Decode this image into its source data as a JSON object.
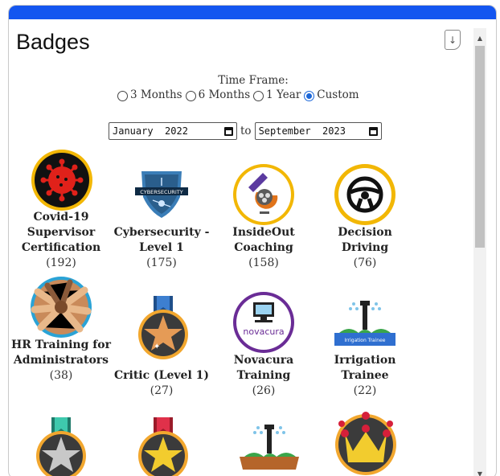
{
  "page": {
    "title": "Badges"
  },
  "toolbar": {
    "download_icon": "download-icon",
    "download_glyph": "↓"
  },
  "timeframe": {
    "label": "Time Frame:",
    "options": [
      "3 Months",
      "6 Months",
      "1 Year",
      "Custom"
    ],
    "selected": "Custom",
    "start": "January  2022",
    "separator": "to",
    "end": "September  2023"
  },
  "badges": [
    {
      "name": "Covid-19 Supervisor Certification",
      "count": "(192)",
      "icon": "virus-badge-icon"
    },
    {
      "name": "Cybersecurity - Level 1",
      "count": "(175)",
      "icon": "cybersecurity-shield-icon"
    },
    {
      "name": "InsideOut Coaching",
      "count": "(158)",
      "icon": "insideout-badge-icon"
    },
    {
      "name": "Decision Driving",
      "count": "(76)",
      "icon": "steering-wheel-icon"
    },
    {
      "name": "HR Training for Administrators",
      "count": "(38)",
      "icon": "team-hands-icon"
    },
    {
      "name": "Critic (Level 1)",
      "count": "(27)",
      "icon": "bronze-star-medal-icon"
    },
    {
      "name": "Novacura Training",
      "count": "(26)",
      "icon": "novacura-computer-icon"
    },
    {
      "name": "Irrigation Trainee",
      "count": "(22)",
      "icon": "irrigation-sprinkler-icon"
    },
    {
      "name": "",
      "count": "",
      "icon": "silver-star-medal-icon"
    },
    {
      "name": "",
      "count": "",
      "icon": "gold-star-medal-icon"
    },
    {
      "name": "",
      "count": "",
      "icon": "irrigation-tech-icon"
    },
    {
      "name": "",
      "count": "",
      "icon": "crown-badge-icon"
    }
  ],
  "colors": {
    "accent": "#1456f0",
    "radio": "#1a66d8"
  }
}
